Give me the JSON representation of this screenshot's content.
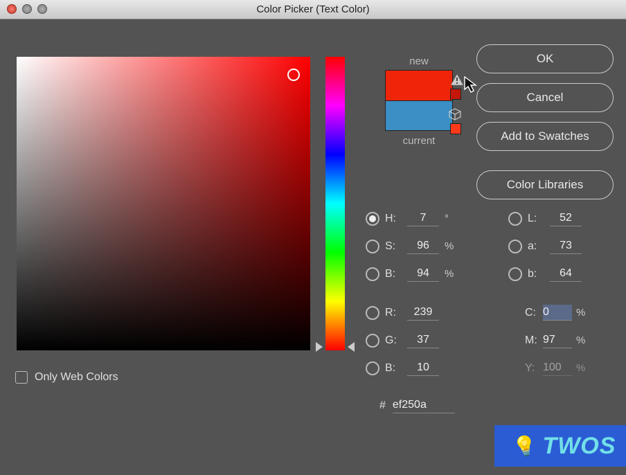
{
  "window": {
    "title": "Color Picker (Text Color)"
  },
  "buttons": {
    "ok": "OK",
    "cancel": "Cancel",
    "add_swatches": "Add to Swatches",
    "color_libraries": "Color Libraries"
  },
  "swatch": {
    "new_label": "new",
    "current_label": "current",
    "new_color": "#ef250a",
    "current_color": "#3b8fc4"
  },
  "hsb": {
    "h_label": "H:",
    "h_value": "7",
    "h_unit": "°",
    "s_label": "S:",
    "s_value": "96",
    "s_unit": "%",
    "b_label": "B:",
    "b_value": "94",
    "b_unit": "%"
  },
  "rgb": {
    "r_label": "R:",
    "r_value": "239",
    "g_label": "G:",
    "g_value": "37",
    "b_label": "B:",
    "b_value": "10"
  },
  "lab": {
    "l_label": "L:",
    "l_value": "52",
    "a_label": "a:",
    "a_value": "73",
    "b_label": "b:",
    "b_value": "64"
  },
  "cmyk": {
    "c_label": "C:",
    "c_value": "0",
    "c_unit": "%",
    "m_label": "M:",
    "m_value": "97",
    "m_unit": "%",
    "y_label": "Y:",
    "y_value": "100",
    "y_unit": "%"
  },
  "hex": {
    "label": "#",
    "value": "ef250a"
  },
  "web_colors": {
    "label": "Only Web Colors",
    "checked": false
  },
  "watermark": {
    "text": "TWOS"
  }
}
